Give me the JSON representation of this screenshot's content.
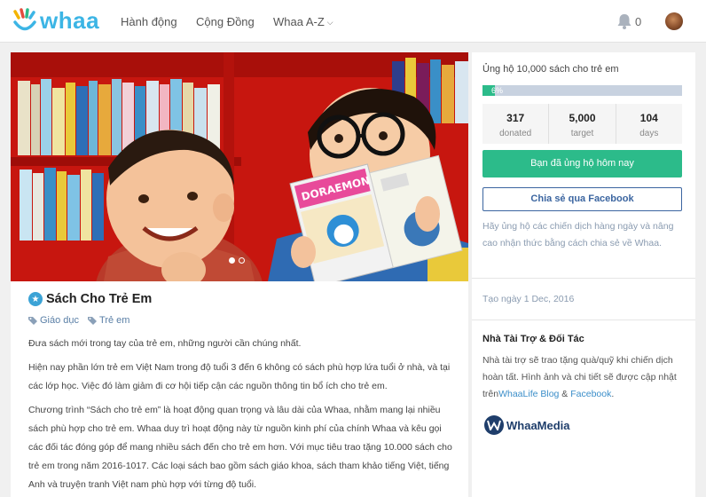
{
  "nav": {
    "logo_text": "whaa",
    "items": [
      {
        "label": "Hành động"
      },
      {
        "label": "Cộng Đồng"
      },
      {
        "label": "Whaa A-Z"
      }
    ],
    "notification_count": "0"
  },
  "campaign": {
    "title": "Sách Cho Trẻ Em",
    "tags": [
      "Giáo dục",
      "Trẻ em"
    ],
    "hero_book_title": "DORAEMON",
    "carousel": {
      "slides": 2,
      "active": 1
    },
    "paragraphs": [
      "Đưa sách mới trong tay của trẻ em, những người cần chúng nhất.",
      "Hiện nay phần lớn trẻ em Việt Nam trong độ tuổi 3 đến 6 không có sách phù hợp lứa tuổi ở nhà, và tại các lớp học. Việc đó làm giảm đi cơ hội tiếp cận các nguồn thông tin bổ ích cho trẻ em.",
      "Chương trình “Sách cho trẻ em” là hoạt động quan trọng và lâu dài của Whaa, nhằm mang lại nhiều sách phù hợp cho trẻ em. Whaa duy trì hoạt động này từ nguồn kinh phí của chính Whaa và kêu gọi các đối tác đóng góp để mang nhiều sách đến cho trẻ em hơn. Với mục tiêu trao tặng 10.000 sách cho trẻ em trong năm 2016-1017. Các loại sách bao gồm sách giáo khoa, sách tham khảo tiếng Việt, tiếng Anh và truyện tranh Việt nam phù hợp với từng độ tuổi."
    ]
  },
  "sidebar": {
    "goal_title": "Ủng hộ 10,000 sách cho trẻ em",
    "progress_percent": 6,
    "progress_label": "6%",
    "stats": [
      {
        "value": "317",
        "label": "donated"
      },
      {
        "value": "5,000",
        "label": "target"
      },
      {
        "value": "104",
        "label": "days"
      }
    ],
    "donated_button": "Bạn đã ủng hộ hôm nay",
    "share_button": "Chia sẻ qua Facebook",
    "share_note": "Hãy ủng hộ các chiến dịch hàng ngày và nâng cao nhận thức bằng cách chia sẻ về Whaa.",
    "created_date": "Tạo ngày 1 Dec, 2016",
    "sponsor": {
      "title": "Nhà Tài Trợ & Đối Tác",
      "text_before": "Nhà tài trợ sẽ trao tặng quà/quỹ khi chiến dịch hoàn tất. Hình ảnh và chi tiết sẽ được cập nhật trên",
      "link1": "WhaaLife Blog",
      "amp": " & ",
      "link2": "Facebook",
      "text_after": ".",
      "logo_text": "WhaaMedia"
    }
  },
  "colors": {
    "brand": "#3cb5e5",
    "accent_green": "#2cbb8a",
    "facebook_blue": "#3b65a0"
  }
}
